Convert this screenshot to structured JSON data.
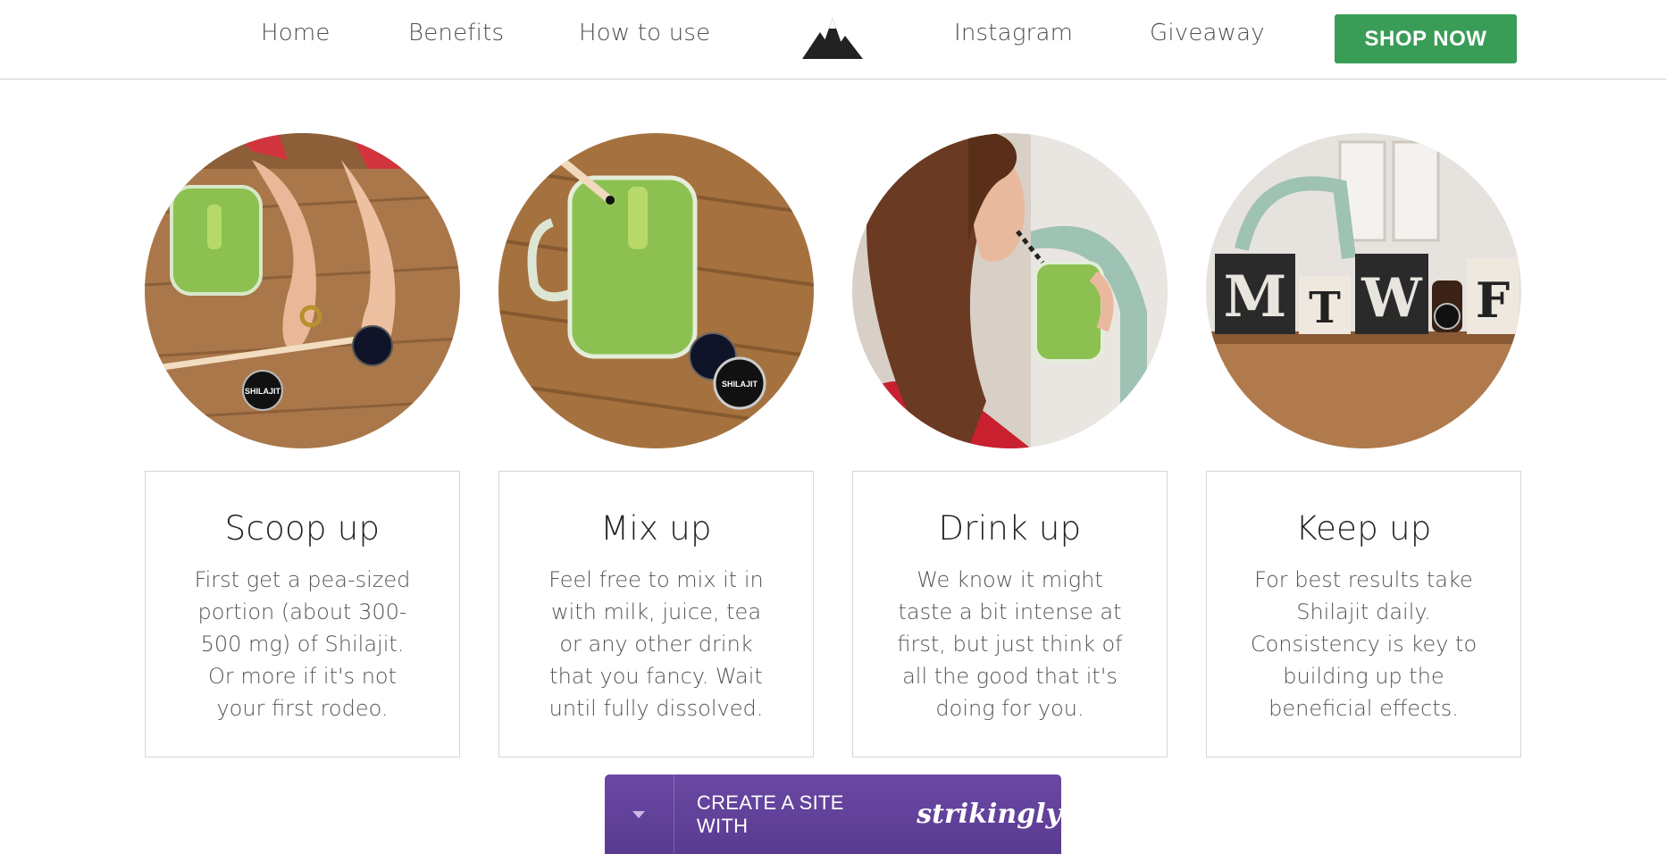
{
  "nav": {
    "links": [
      "Home",
      "Benefits",
      "How to use",
      "Instagram",
      "Giveaway"
    ],
    "shop_label": "SHOP NOW",
    "logo_icon": "mountain-logo-icon"
  },
  "steps": [
    {
      "title": "Scoop up",
      "text": "First get a pea-sized\nportion (about 300-\n500 mg) of Shilajit.\nOr more if it's not\nyour first rodeo.",
      "image": "hands-scooping-shilajit-photo"
    },
    {
      "title": "Mix up",
      "text": "Feel free to mix it in\nwith milk, juice, tea\nor any other drink\nthat you fancy. Wait\nuntil fully dissolved.",
      "image": "green-smoothie-jar-photo"
    },
    {
      "title": "Drink up",
      "text": "We know it might\ntaste a bit intense at\nfirst, but just think of\nall the good that it's\ndoing for you.",
      "image": "woman-drinking-smoothie-photo"
    },
    {
      "title": "Keep up",
      "text": "For best results take\nShilajit daily.\nConsistency is key to\nbuilding up the\nbeneficial effects.",
      "image": "weekday-blocks-photo"
    }
  ],
  "jar_label": "SHILAJIT",
  "blocks": [
    "M",
    "T",
    "W",
    "F"
  ],
  "footer_bar": {
    "cta": "CREATE A SITE WITH",
    "brand": "strikingly"
  },
  "colors": {
    "shop_button": "#3a9d57",
    "strikingly_bar": "#5e3f96",
    "smoothie": "#8cc152",
    "wood": "#9a6a3f"
  }
}
